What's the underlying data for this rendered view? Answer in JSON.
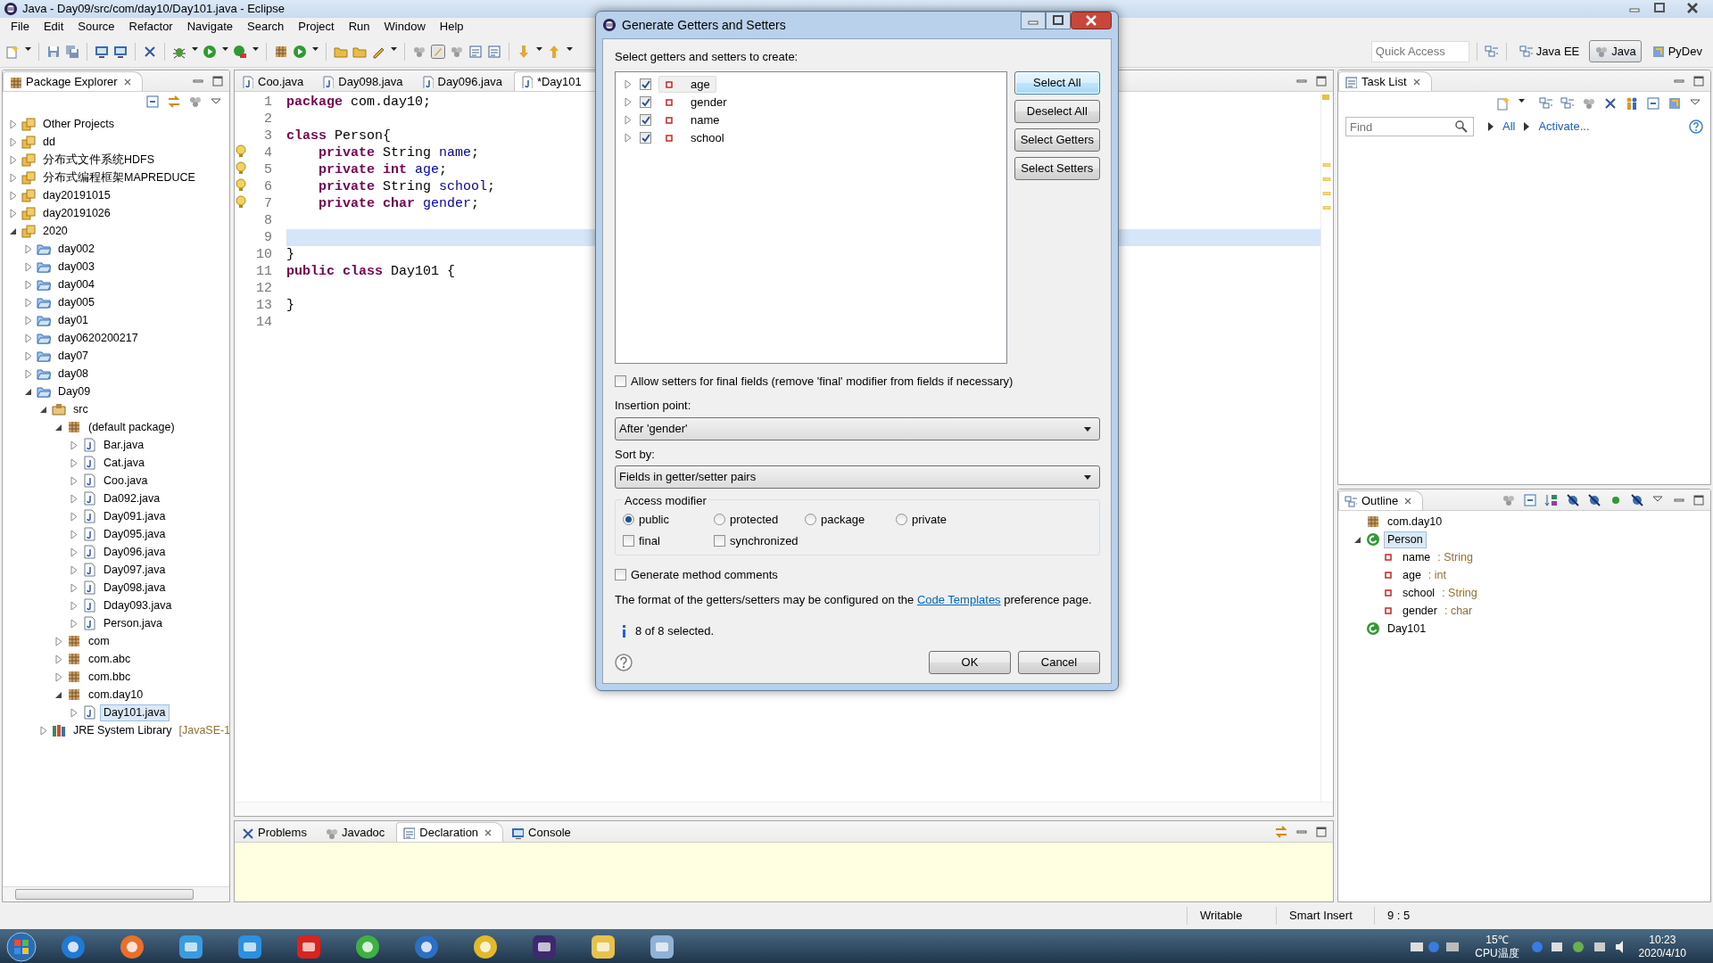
{
  "window": {
    "title": "Java - Day09/src/com/day10/Day101.java - Eclipse"
  },
  "menu": [
    "File",
    "Edit",
    "Source",
    "Refactor",
    "Navigate",
    "Search",
    "Project",
    "Run",
    "Window",
    "Help"
  ],
  "toolbar": {
    "quick_access": {
      "placeholder": "Quick Access"
    },
    "perspectives": [
      {
        "label": "Java EE",
        "selected": false
      },
      {
        "label": "Java",
        "selected": true
      },
      {
        "label": "PyDev",
        "selected": false
      }
    ]
  },
  "package_explorer": {
    "title": "Package Explorer",
    "tree": [
      {
        "label": "Other Projects",
        "kind": "workingset",
        "expanded": false,
        "selected": false
      },
      {
        "label": "dd",
        "kind": "workingset",
        "expanded": false,
        "selected": false
      },
      {
        "label": "分布式文件系统HDFS",
        "kind": "workingset",
        "expanded": false,
        "selected": false
      },
      {
        "label": "分布式编程框架MAPREDUCE",
        "kind": "workingset",
        "expanded": false,
        "selected": false
      },
      {
        "label": "day20191015",
        "kind": "workingset",
        "expanded": false,
        "selected": false
      },
      {
        "label": "day20191026",
        "kind": "workingset",
        "expanded": false,
        "selected": false
      },
      {
        "label": "2020",
        "kind": "workingset",
        "expanded": true,
        "selected": false,
        "children": [
          {
            "label": "day002",
            "kind": "project",
            "expanded": false,
            "selected": false
          },
          {
            "label": "day003",
            "kind": "project",
            "expanded": false,
            "selected": false
          },
          {
            "label": "day004",
            "kind": "project",
            "expanded": false,
            "selected": false
          },
          {
            "label": "day005",
            "kind": "project",
            "expanded": false,
            "selected": false
          },
          {
            "label": "day01",
            "kind": "project",
            "expanded": false,
            "selected": false
          },
          {
            "label": "day0620200217",
            "kind": "project",
            "expanded": false,
            "selected": false
          },
          {
            "label": "day07",
            "kind": "project",
            "expanded": false,
            "selected": false
          },
          {
            "label": "day08",
            "kind": "project",
            "expanded": false,
            "selected": false
          },
          {
            "label": "Day09",
            "kind": "project",
            "expanded": true,
            "selected": false,
            "children": [
              {
                "label": "src",
                "kind": "srcfolder",
                "expanded": true,
                "selected": false,
                "children": [
                  {
                    "label": "(default package)",
                    "kind": "package",
                    "expanded": true,
                    "selected": false,
                    "children": [
                      {
                        "label": "Bar.java",
                        "kind": "file",
                        "expanded": false,
                        "selected": false
                      },
                      {
                        "label": "Cat.java",
                        "kind": "file",
                        "expanded": false,
                        "selected": false
                      },
                      {
                        "label": "Coo.java",
                        "kind": "file",
                        "expanded": false,
                        "selected": false
                      },
                      {
                        "label": "Da092.java",
                        "kind": "file",
                        "expanded": false,
                        "selected": false
                      },
                      {
                        "label": "Day091.java",
                        "kind": "file",
                        "expanded": false,
                        "selected": false
                      },
                      {
                        "label": "Day095.java",
                        "kind": "file",
                        "expanded": false,
                        "selected": false
                      },
                      {
                        "label": "Day096.java",
                        "kind": "file",
                        "expanded": false,
                        "selected": false
                      },
                      {
                        "label": "Day097.java",
                        "kind": "file",
                        "expanded": false,
                        "selected": false
                      },
                      {
                        "label": "Day098.java",
                        "kind": "file",
                        "expanded": false,
                        "selected": false
                      },
                      {
                        "label": "Dday093.java",
                        "kind": "file",
                        "expanded": false,
                        "selected": false
                      },
                      {
                        "label": "Person.java",
                        "kind": "file",
                        "expanded": false,
                        "selected": false
                      }
                    ]
                  },
                  {
                    "label": "com",
                    "kind": "package",
                    "expanded": false,
                    "selected": false
                  },
                  {
                    "label": "com.abc",
                    "kind": "package",
                    "expanded": false,
                    "selected": false
                  },
                  {
                    "label": "com.bbc",
                    "kind": "package",
                    "expanded": false,
                    "selected": false
                  },
                  {
                    "label": "com.day10",
                    "kind": "package",
                    "expanded": true,
                    "selected": false,
                    "children": [
                      {
                        "label": "Day101.java",
                        "kind": "file",
                        "expanded": false,
                        "selected": true
                      }
                    ]
                  }
                ]
              },
              {
                "label": "JRE System Library",
                "decoration": "[JavaSE-1",
                "kind": "library",
                "expanded": false,
                "selected": false
              }
            ]
          }
        ]
      }
    ]
  },
  "editor": {
    "tabs": [
      {
        "label": "Coo.java",
        "selected": false
      },
      {
        "label": "Day098.java",
        "selected": false
      },
      {
        "label": "Day096.java",
        "selected": false
      },
      {
        "label": "*Day101",
        "selected": true
      }
    ],
    "lines": [
      {
        "number": "1",
        "current": false,
        "kind": "plain",
        "tokens": [
          {
            "kind": "keyword",
            "text": "package"
          },
          {
            "kind": "plain",
            "text": " com.day10;"
          }
        ]
      },
      {
        "number": "2",
        "current": false,
        "kind": "plain"
      },
      {
        "number": "3",
        "current": false,
        "kind": "plain",
        "tokens": [
          {
            "kind": "keyword",
            "text": "class"
          },
          {
            "kind": "plain",
            "text": " Person{"
          }
        ]
      },
      {
        "number": "4",
        "current": false,
        "kind": "warning",
        "tokens": [
          {
            "kind": "keyword",
            "text": "    private"
          },
          {
            "kind": "plain",
            "text": " String "
          },
          {
            "kind": "field",
            "text": "name"
          },
          {
            "kind": "plain",
            "text": ";"
          }
        ]
      },
      {
        "number": "5",
        "current": false,
        "kind": "warning",
        "tokens": [
          {
            "kind": "keyword",
            "text": "    private"
          },
          {
            "kind": "keyword",
            "text": " int"
          },
          {
            "kind": "field",
            "text": " age"
          },
          {
            "kind": "plain",
            "text": ";"
          }
        ]
      },
      {
        "number": "6",
        "current": false,
        "kind": "warning",
        "tokens": [
          {
            "kind": "keyword",
            "text": "    private"
          },
          {
            "kind": "plain",
            "text": " String "
          },
          {
            "kind": "field",
            "text": "school"
          },
          {
            "kind": "plain",
            "text": ";"
          }
        ]
      },
      {
        "number": "7",
        "current": false,
        "kind": "warning",
        "tokens": [
          {
            "kind": "keyword",
            "text": "    private"
          },
          {
            "kind": "keyword",
            "text": " char"
          },
          {
            "kind": "field",
            "text": " gender"
          },
          {
            "kind": "plain",
            "text": ";"
          }
        ]
      },
      {
        "number": "8",
        "current": false,
        "kind": "plain"
      },
      {
        "number": "9",
        "current": true,
        "kind": "plain"
      },
      {
        "number": "10",
        "current": false,
        "kind": "plain",
        "tokens": [
          {
            "kind": "plain",
            "text": "}"
          }
        ]
      },
      {
        "number": "11",
        "current": false,
        "kind": "plain",
        "tokens": [
          {
            "kind": "keyword",
            "text": "public"
          },
          {
            "kind": "keyword",
            "text": " class"
          },
          {
            "kind": "plain",
            "text": " Day101 {"
          }
        ]
      },
      {
        "number": "12",
        "current": false,
        "kind": "plain"
      },
      {
        "number": "13",
        "current": false,
        "kind": "plain",
        "tokens": [
          {
            "kind": "plain",
            "text": "}"
          }
        ]
      },
      {
        "number": "14",
        "current": false,
        "kind": "plain"
      }
    ]
  },
  "bottom_panel": {
    "tabs": [
      {
        "label": "Problems",
        "selected": false
      },
      {
        "label": "Javadoc",
        "selected": false
      },
      {
        "label": "Declaration",
        "selected": true
      },
      {
        "label": "Console",
        "selected": false
      }
    ]
  },
  "task_list": {
    "title": "Task List",
    "find": {
      "placeholder": "Find"
    },
    "links": [
      "All",
      "Activate..."
    ]
  },
  "outline": {
    "title": "Outline",
    "items": [
      {
        "label": "com.day10",
        "kind": "package",
        "selected": false
      },
      {
        "label": "Person",
        "kind": "class",
        "expanded": true,
        "selected": true,
        "children": [
          {
            "label": "name",
            "type": ": String",
            "kind": "field",
            "selected": false
          },
          {
            "label": "age",
            "type": ": int",
            "kind": "field",
            "selected": false
          },
          {
            "label": "school",
            "type": ": String",
            "kind": "field",
            "selected": false
          },
          {
            "label": "gender",
            "type": ": char",
            "kind": "field",
            "selected": false
          }
        ]
      },
      {
        "label": "Day101",
        "kind": "class",
        "selected": false
      }
    ]
  },
  "status_bar": [
    "Writable",
    "Smart Insert",
    "9 : 5"
  ],
  "taskbar": {
    "temperature": "15℃",
    "sensor": "CPU温度",
    "time": "10:23",
    "date": "2020/4/10"
  },
  "dialog": {
    "title": "Generate Getters and Setters",
    "prompt": "Select getters and setters to create:",
    "fields": [
      {
        "label": "age",
        "checked": true,
        "selected": true
      },
      {
        "label": "gender",
        "checked": true,
        "selected": false
      },
      {
        "label": "name",
        "checked": true,
        "selected": false
      },
      {
        "label": "school",
        "checked": true,
        "selected": false
      }
    ],
    "buttons": [
      {
        "label": "Select All",
        "focused": true
      },
      {
        "label": "Deselect All",
        "focused": false
      },
      {
        "label": "Select Getters",
        "focused": false
      },
      {
        "label": "Select Setters",
        "focused": false
      }
    ],
    "allow_final": {
      "label": "Allow setters for final fields (remove 'final' modifier from fields if necessary)",
      "checked": false
    },
    "insertion_point": {
      "label": "Insertion point:",
      "value": "After 'gender'"
    },
    "sort_by": {
      "label": "Sort by:",
      "value": "Fields in getter/setter pairs"
    },
    "access_modifier": {
      "title": "Access modifier",
      "options": [
        {
          "label": "public",
          "selected": true
        },
        {
          "label": "protected",
          "selected": false
        },
        {
          "label": "package",
          "selected": false
        },
        {
          "label": "private",
          "selected": false
        }
      ],
      "flags": [
        {
          "label": "final",
          "checked": false
        },
        {
          "label": "synchronized",
          "checked": false
        }
      ]
    },
    "comments": {
      "label": "Generate method comments",
      "checked": false
    },
    "note": {
      "before": "The format of the getters/setters may be configured on the ",
      "link": "Code Templates",
      "after": " preference page."
    },
    "status": "8 of 8 selected.",
    "ok": "OK",
    "cancel": "Cancel"
  }
}
